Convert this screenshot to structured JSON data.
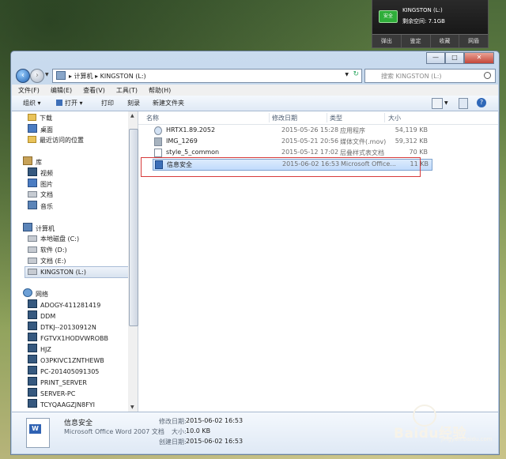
{
  "tray_popup": {
    "icon_text": "安全",
    "drive_name": "KINGSTON (L:)",
    "free_space": "剩余空间: 7.1GB",
    "buttons": [
      "弹出",
      "鉴定",
      "收藏",
      "网盾"
    ]
  },
  "window": {
    "caption_buttons": [
      "—",
      "□",
      "✕"
    ],
    "address": {
      "path": "▸ 计算机 ▸ KINGSTON (L:)"
    },
    "search": {
      "placeholder": "搜索 KINGSTON (L:)"
    },
    "menu": [
      "文件(F)",
      "编辑(E)",
      "查看(V)",
      "工具(T)",
      "帮助(H)"
    ],
    "toolbar": [
      "组织 ▾",
      "打开 ▾",
      "打印",
      "刻录",
      "新建文件夹"
    ]
  },
  "sidebar": {
    "favorites": [
      "下载",
      "桌面",
      "最近访问的位置"
    ],
    "libraries_header": "库",
    "libraries": [
      "视频",
      "图片",
      "文档",
      "音乐"
    ],
    "computer_header": "计算机",
    "drives": [
      "本地磁盘 (C:)",
      "软件 (D:)",
      "文档 (E:)",
      "KINGSTON (L:)"
    ],
    "network_header": "网络",
    "network": [
      "ADOGY-411281419",
      "DDM",
      "DTKJ--20130912N",
      "FGTVX1HODVWROBB",
      "HJZ",
      "O3PKIVC1ZNTHEWB",
      "PC-201405091305",
      "PRINT_SERVER",
      "SERVER-PC",
      "TCYQAAGZJN8FYI"
    ]
  },
  "columns": {
    "name": "名称",
    "date": "修改日期",
    "type": "类型",
    "size": "大小"
  },
  "files": [
    {
      "name": "HRTX1.89.2052",
      "date": "2015-05-26 15:28",
      "type": "应用程序",
      "size": "54,119 KB",
      "icon": "exe"
    },
    {
      "name": "IMG_1269",
      "date": "2015-05-21 20:56",
      "type": "媒体文件(.mov)",
      "size": "59,312 KB",
      "icon": "mov"
    },
    {
      "name": "style_5_common",
      "date": "2015-05-12 17:02",
      "type": "层叠样式表文档",
      "size": "70 KB",
      "icon": "css"
    },
    {
      "name": "信息安全",
      "date": "2015-06-02 16:53",
      "type": "Microsoft Office...",
      "size": "11 KB",
      "icon": "doc"
    }
  ],
  "details": {
    "title": "信息安全",
    "subtitle": "Microsoft Office Word 2007 文档",
    "modified_label": "修改日期:",
    "modified": "2015-06-02 16:53",
    "size_label": "大小:",
    "size": "10.0 KB",
    "created_label": "创建日期:",
    "created": "2015-06-02 16:53"
  },
  "watermark": {
    "text": "Baidu经验",
    "sub": "jingyan.baidu.com"
  }
}
